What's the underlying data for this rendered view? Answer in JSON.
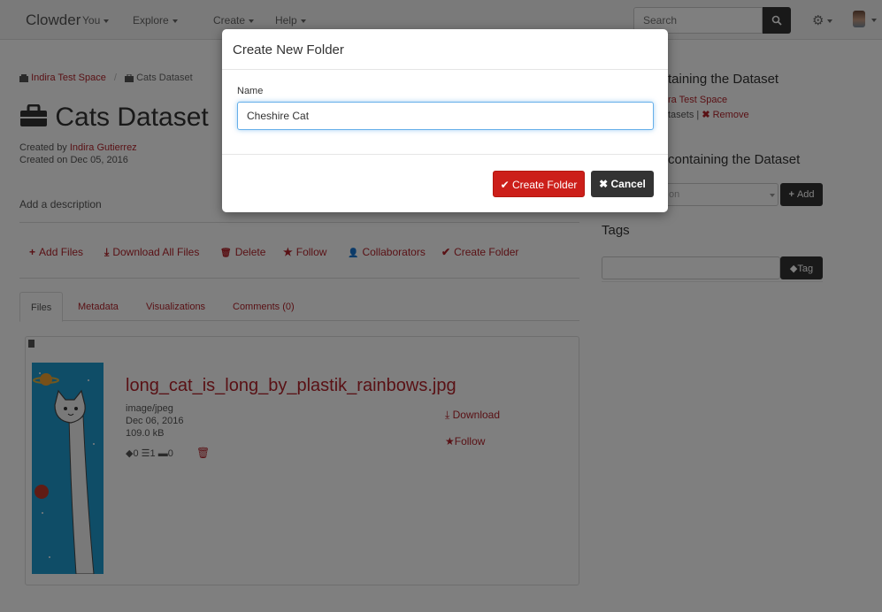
{
  "navbar": {
    "brand": "Clowder",
    "items": [
      {
        "label": "You"
      },
      {
        "label": "Explore"
      },
      {
        "label": "Create"
      },
      {
        "label": "Help"
      }
    ],
    "search_placeholder": "Search"
  },
  "breadcrumb": {
    "space": "Indira Test Space",
    "sep": "/",
    "dataset": "Cats Dataset"
  },
  "dataset": {
    "title": "Cats Dataset",
    "created_by_prefix": "Created by ",
    "author": "Indira Gutierrez",
    "created_on": "Created on Dec 05, 2016",
    "add_description": "Add a description"
  },
  "actions": [
    {
      "sym": "+",
      "label": "Add Files"
    },
    {
      "sym": "⤓",
      "label": "Download All Files"
    },
    {
      "sym": "🗑",
      "label": "Delete"
    },
    {
      "sym": "★",
      "label": "Follow"
    },
    {
      "sym": "👤",
      "label": "Collaborators"
    },
    {
      "sym": "✔",
      "label": "Create Folder"
    }
  ],
  "tabs": [
    {
      "label": "Files",
      "active": true
    },
    {
      "label": "Metadata"
    },
    {
      "label": "Visualizations"
    },
    {
      "label": "Comments (0)"
    }
  ],
  "file": {
    "name": "long_cat_is_long_by_plastik_rainbows.jpg",
    "type": "image/jpeg",
    "date": "Dec 06, 2016",
    "size": "109.0 kB",
    "tags_count": "0",
    "metadata_count": "1",
    "comments_count": "0",
    "download_label": "Download",
    "follow_label": "Follow"
  },
  "right": {
    "spaces_heading": "taining the Dataset",
    "space_link": "ra Test Space",
    "datasets_text": "tasets |",
    "remove_label": "Remove",
    "collections_heading": "containing the Dataset",
    "collection_select": "on",
    "add_label": "Add",
    "tags_heading": "Tags",
    "tag_button": "Tag"
  },
  "modal": {
    "title": "Create New Folder",
    "name_label": "Name",
    "name_value": "Cheshire Cat",
    "create_label": "Create Folder",
    "cancel_label": "Cancel"
  },
  "colors": {
    "accent": "#b3232a",
    "create_button": "#cc1f1a",
    "dark": "#333333"
  }
}
